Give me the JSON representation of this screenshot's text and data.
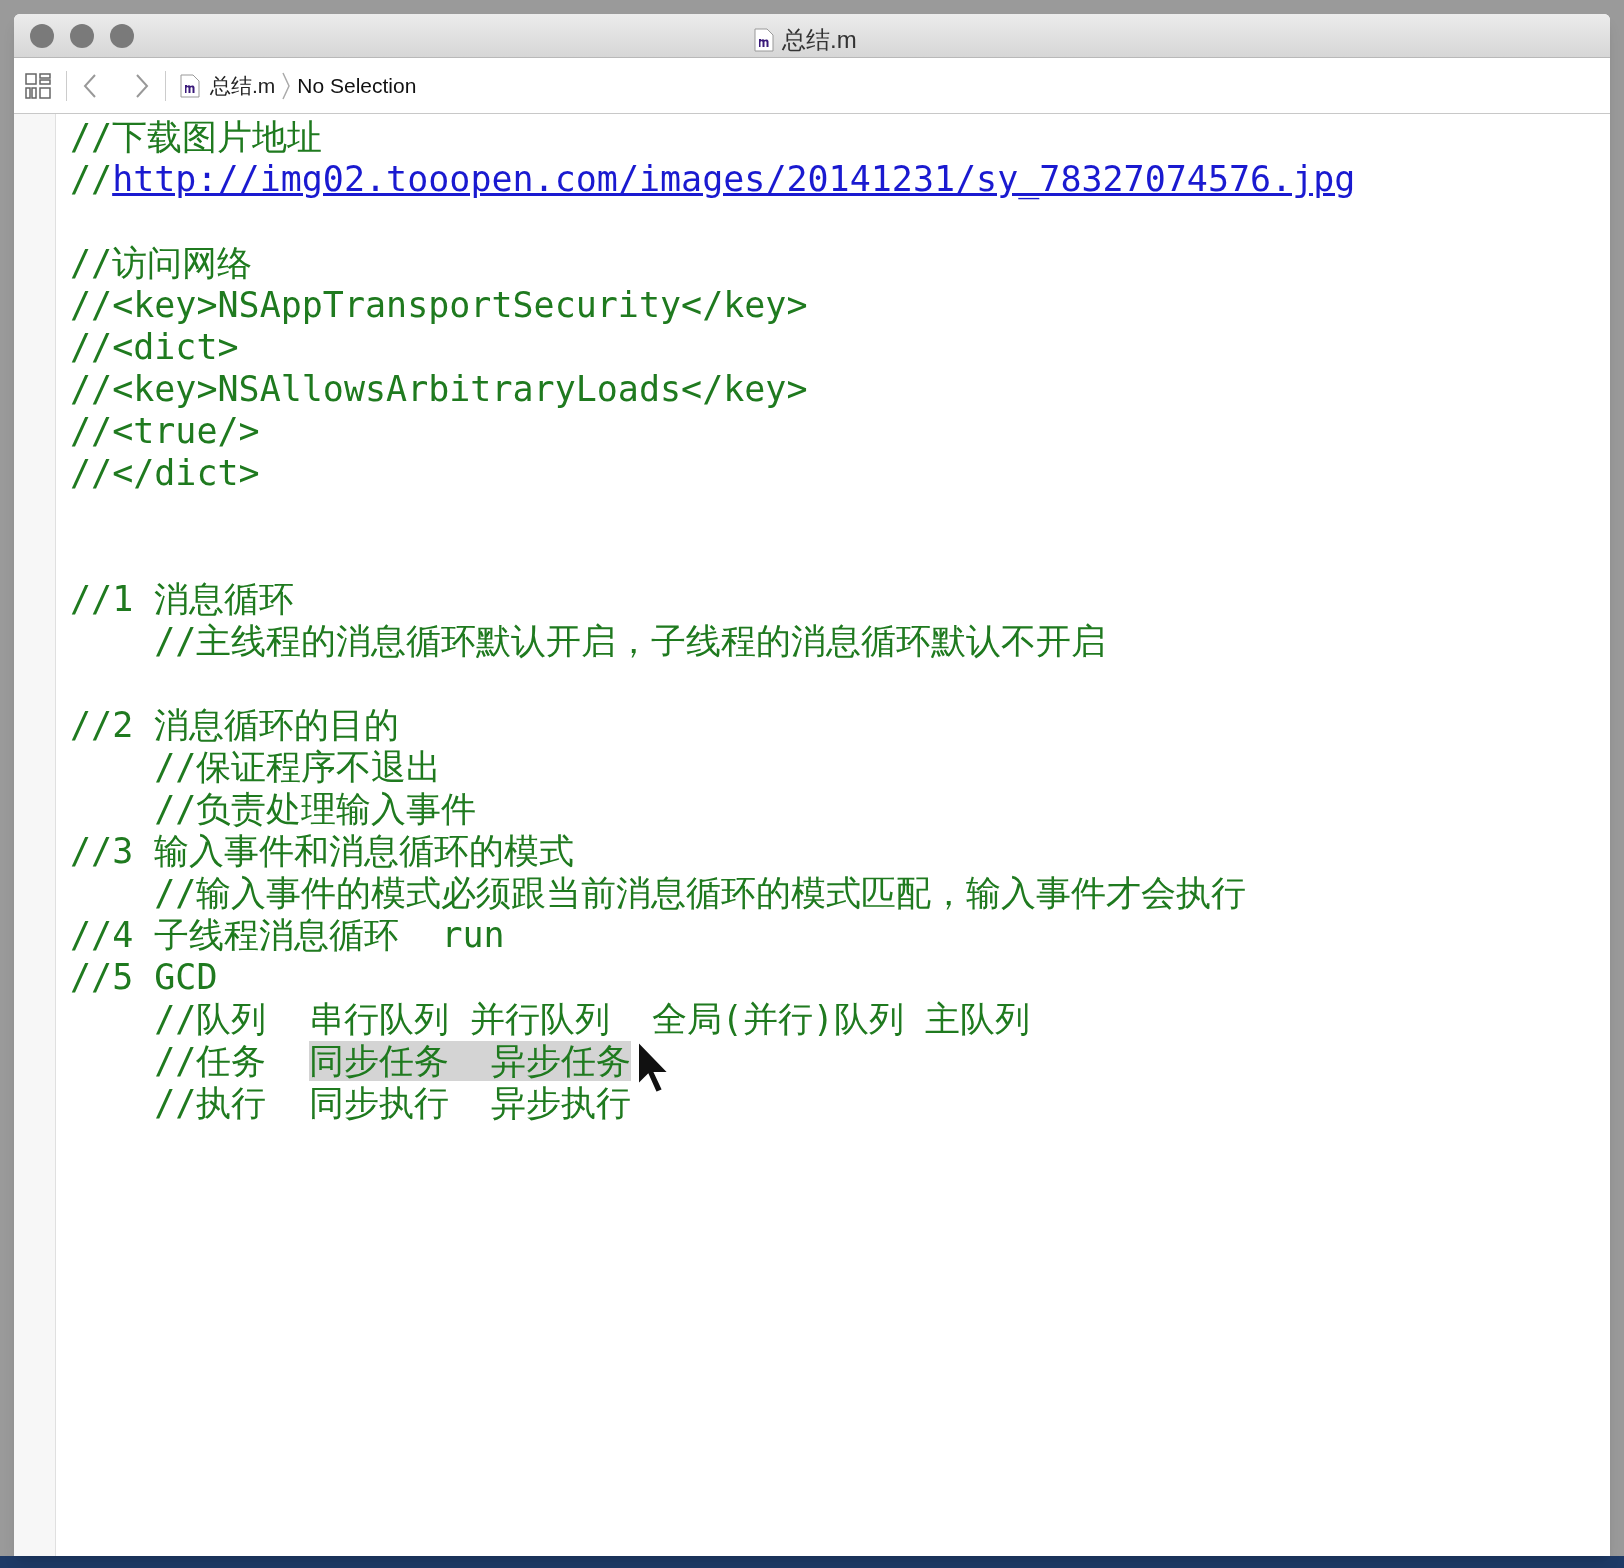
{
  "window": {
    "title": "总结.m"
  },
  "jump_bar": {
    "file": "总结.m",
    "selection": "No Selection"
  },
  "editor": {
    "lines": [
      {
        "kind": "code",
        "segments": [
          {
            "kind": "text",
            "text": "//下载图片地址"
          }
        ]
      },
      {
        "kind": "code",
        "segments": [
          {
            "kind": "text",
            "text": "//"
          },
          {
            "kind": "link",
            "text": "http://img02.tooopen.com/images/20141231/sy_78327074576.jpg"
          }
        ]
      },
      {
        "kind": "blank"
      },
      {
        "kind": "code",
        "segments": [
          {
            "kind": "text",
            "text": "//访问网络"
          }
        ]
      },
      {
        "kind": "code",
        "segments": [
          {
            "kind": "text",
            "text": "//<key>NSAppTransportSecurity</key>"
          }
        ]
      },
      {
        "kind": "code",
        "segments": [
          {
            "kind": "text",
            "text": "//<dict>"
          }
        ]
      },
      {
        "kind": "code",
        "segments": [
          {
            "kind": "text",
            "text": "//<key>NSAllowsArbitraryLoads</key>"
          }
        ]
      },
      {
        "kind": "code",
        "segments": [
          {
            "kind": "text",
            "text": "//<true/>"
          }
        ]
      },
      {
        "kind": "code",
        "segments": [
          {
            "kind": "text",
            "text": "//</dict>"
          }
        ]
      },
      {
        "kind": "blank"
      },
      {
        "kind": "blank"
      },
      {
        "kind": "code",
        "segments": [
          {
            "kind": "text",
            "text": "//1 消息循环"
          }
        ]
      },
      {
        "kind": "code",
        "segments": [
          {
            "kind": "text",
            "text": "    //主线程的消息循环默认开启，子线程的消息循环默认不开启"
          }
        ]
      },
      {
        "kind": "blank"
      },
      {
        "kind": "code",
        "segments": [
          {
            "kind": "text",
            "text": "//2 消息循环的目的"
          }
        ]
      },
      {
        "kind": "code",
        "segments": [
          {
            "kind": "text",
            "text": "    //保证程序不退出"
          }
        ]
      },
      {
        "kind": "code",
        "segments": [
          {
            "kind": "text",
            "text": "    //负责处理输入事件"
          }
        ]
      },
      {
        "kind": "code",
        "segments": [
          {
            "kind": "text",
            "text": "//3 输入事件和消息循环的模式"
          }
        ]
      },
      {
        "kind": "code",
        "segments": [
          {
            "kind": "text",
            "text": "    //输入事件的模式必须跟当前消息循环的模式匹配，输入事件才会执行"
          }
        ]
      },
      {
        "kind": "code",
        "segments": [
          {
            "kind": "text",
            "text": "//4 子线程消息循环  run"
          }
        ]
      },
      {
        "kind": "code",
        "segments": [
          {
            "kind": "text",
            "text": "//5 GCD"
          }
        ]
      },
      {
        "kind": "code",
        "segments": [
          {
            "kind": "text",
            "text": "    //队列  串行队列 并行队列  全局(并行)队列 主队列"
          }
        ]
      },
      {
        "kind": "code",
        "segments": [
          {
            "kind": "text",
            "text": "    //任务  "
          },
          {
            "kind": "selected",
            "text": "同步任务  异步任务"
          }
        ]
      },
      {
        "kind": "code",
        "segments": [
          {
            "kind": "text",
            "text": "    //执行  同步执行  异步执行"
          }
        ]
      }
    ]
  }
}
